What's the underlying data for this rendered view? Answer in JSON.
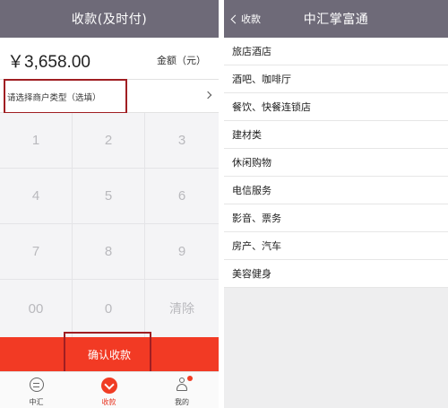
{
  "left": {
    "title": "收款(及时付)",
    "amount": "￥3,658.00",
    "amount_label": "金额（元）",
    "merchant_type_prompt": "请选择商户类型（选填）",
    "keys": [
      "1",
      "2",
      "3",
      "4",
      "5",
      "6",
      "7",
      "8",
      "9",
      "00",
      "0",
      "清除"
    ],
    "confirm_label": "确认收款",
    "tabs": [
      {
        "label": "中汇",
        "icon": "zhonghui-logo-icon"
      },
      {
        "label": "收款",
        "icon": "collect-payment-icon"
      },
      {
        "label": "我的",
        "icon": "profile-icon"
      }
    ]
  },
  "right": {
    "back_label": "收款",
    "title": "中汇掌富通",
    "categories": [
      "旅店酒店",
      "酒吧、咖啡厅",
      "餐饮、快餐连锁店",
      "建材类",
      "休闲购物",
      "电信服务",
      "影音、票务",
      "房产、汽车",
      "美容健身"
    ]
  },
  "colors": {
    "navbar": "#6e6a78",
    "accent_red": "#f23a24",
    "highlight_border": "#a01e22"
  }
}
